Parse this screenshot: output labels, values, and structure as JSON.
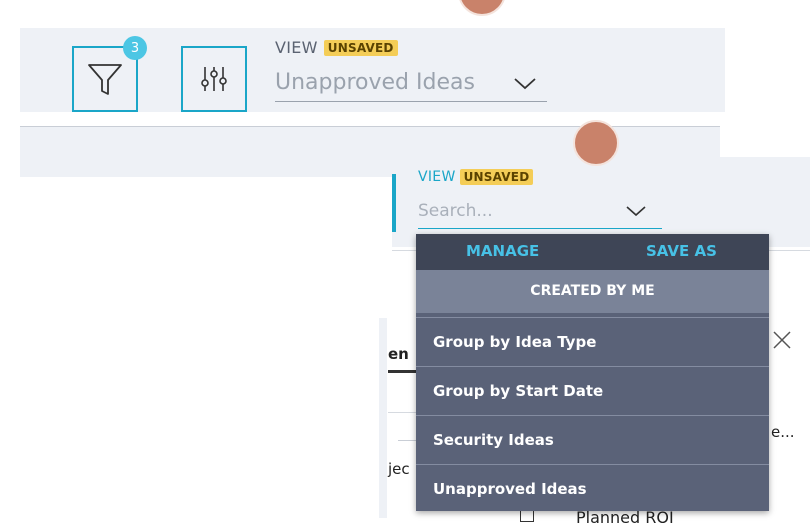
{
  "toolbar": {
    "filter_count": "3",
    "view_label": "VIEW",
    "unsaved_badge": "UNSAVED",
    "selected_view": "Unapproved Ideas"
  },
  "panel": {
    "view_label": "VIEW",
    "unsaved_badge": "UNSAVED",
    "search_placeholder": "Search..."
  },
  "background": {
    "fragment_1": "en",
    "fragment_2": "jec",
    "fragment_3": "e...",
    "fragment_4": "Planned ROI"
  },
  "dropdown": {
    "manage_label": "MANAGE",
    "save_as_label": "SAVE AS",
    "group_header": "CREATED BY ME",
    "items": [
      {
        "label": "Group by Idea Type"
      },
      {
        "label": "Group by Start Date"
      },
      {
        "label": "Security Ideas"
      },
      {
        "label": "Unapproved Ideas"
      }
    ]
  },
  "colors": {
    "accent": "#1aa6c8",
    "badge": "#f4cd57",
    "dropdown_bg": "#5a6278",
    "dropdown_header": "#3e4556"
  }
}
